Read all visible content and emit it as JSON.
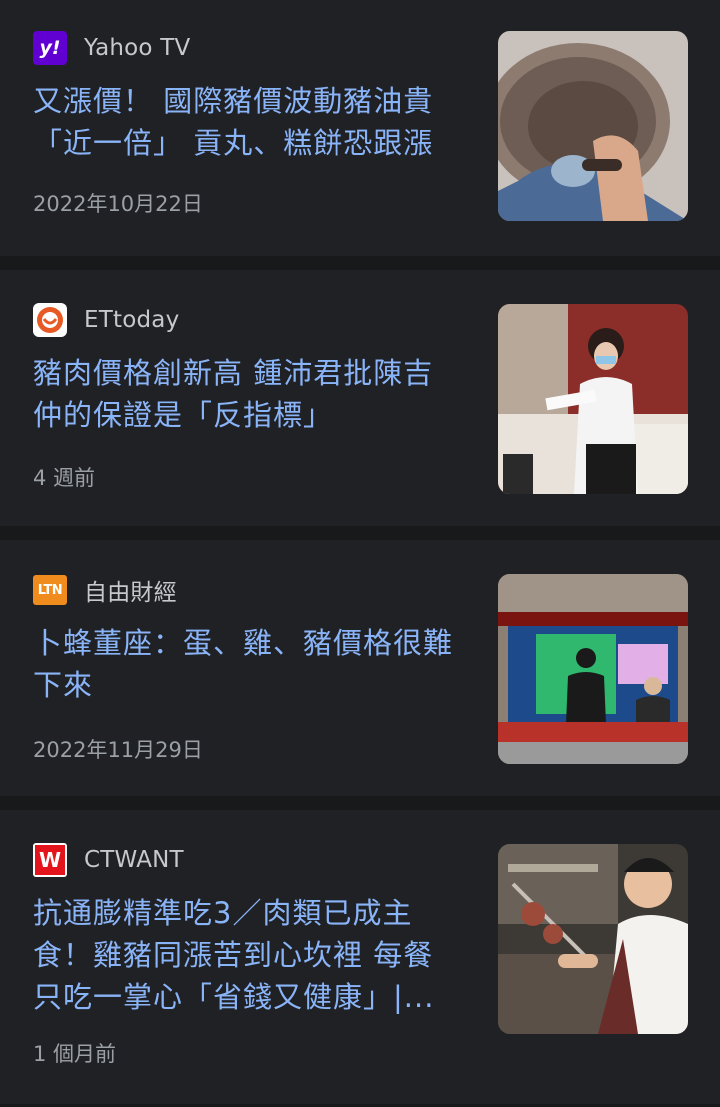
{
  "articles": [
    {
      "source": "Yahoo TV",
      "logo_icon": "yahoo-logo-icon",
      "logo_text": "y!",
      "logo_color": "#6001d2",
      "headline": "又漲價！ 國際豬價波動豬油貴「近一倍」 貢丸、糕餅恐跟漲",
      "time": "2022年10月22日"
    },
    {
      "source": "ETtoday",
      "logo_icon": "ettoday-logo-icon",
      "logo_color": "#e85a24",
      "headline": "豬肉價格創新高 鍾沛君批陳吉仲的保證是「反指標」",
      "time": "4 週前"
    },
    {
      "source": "自由財經",
      "logo_icon": "ltn-logo-icon",
      "logo_text": "LTN",
      "logo_color": "#f08c1e",
      "headline": "卜蜂董座：蛋、雞、豬價格很難下來",
      "time": "2022年11月29日"
    },
    {
      "source": "CTWANT",
      "logo_icon": "ctwant-logo-icon",
      "logo_text": "W",
      "logo_color": "#e3141b",
      "headline": "抗通膨精準吃3／肉類已成主食！雞豬同漲苦到心坎裡 每餐只吃一掌心「省錢又健康」|...",
      "time": "1 個月前"
    }
  ],
  "colors": {
    "card_bg": "#202124",
    "divider": "#18191b",
    "headline": "#8ab4f8",
    "source": "#c6c8cc",
    "meta": "#9aa0a6"
  }
}
